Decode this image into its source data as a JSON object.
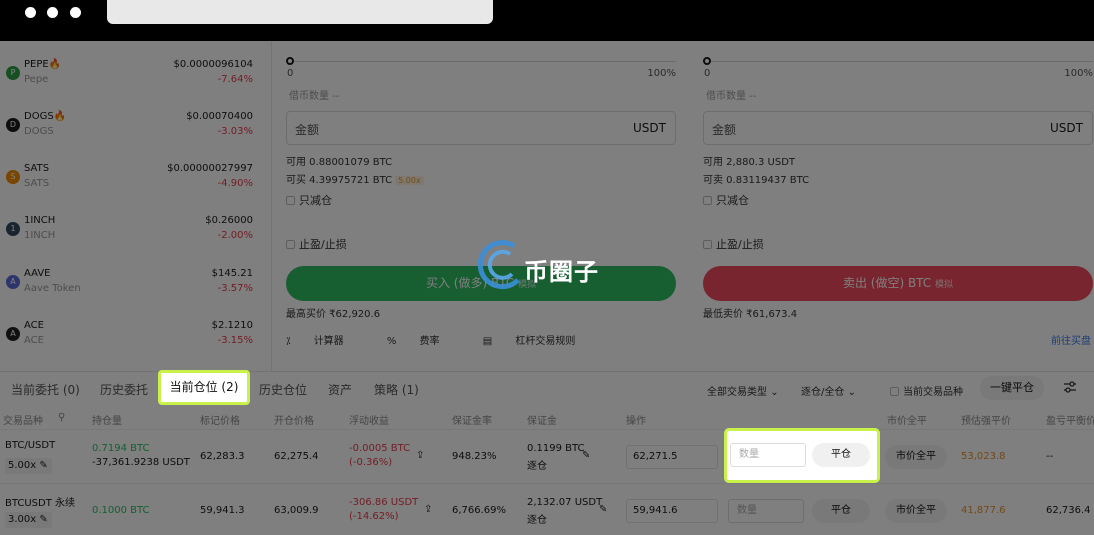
{
  "coins": [
    {
      "name": "PEPE",
      "sub": "Pepe",
      "price": "$0.0000096104",
      "change": "-7.64%",
      "hot": "🔥",
      "color": "#2f9e44",
      "glyph": "P"
    },
    {
      "name": "DOGS",
      "sub": "DOGS",
      "price": "$0.00070400",
      "change": "-3.03%",
      "hot": "🔥",
      "color": "#1a1a1a",
      "glyph": "D"
    },
    {
      "name": "SATS",
      "sub": "SATS",
      "price": "$0.00000027997",
      "change": "-4.90%",
      "hot": "",
      "color": "#f08c00",
      "glyph": "S"
    },
    {
      "name": "1INCH",
      "sub": "1INCH",
      "price": "$0.26000",
      "change": "-2.00%",
      "hot": "",
      "color": "#34495e",
      "glyph": "1"
    },
    {
      "name": "AAVE",
      "sub": "Aave Token",
      "price": "$145.21",
      "change": "-3.57%",
      "hot": "",
      "color": "#5b6bd6",
      "glyph": "A"
    },
    {
      "name": "ACE",
      "sub": "ACE",
      "price": "$2.1210",
      "change": "-3.15%",
      "hot": "",
      "color": "#222222",
      "glyph": "A"
    }
  ],
  "buy_panel": {
    "slider_min": "0",
    "slider_max": "100%",
    "borrow": "借币数量 --",
    "amount_placeholder": "金额",
    "amount_unit": "USDT",
    "available": "可用 0.88001079 BTC",
    "can_buy": "可买 4.39975721 BTC",
    "leverage": "5.00x",
    "reduce_only": "只减仓",
    "tp_sl": "止盈/止损",
    "button": "买入 (做多) BTC",
    "button_suffix": "模拟",
    "best_price": "最高买价 ₹62,920.6",
    "tool_calc": "计算器",
    "tool_rate": "费率",
    "tool_rules": "杠杆交易规则"
  },
  "sell_panel": {
    "slider_min": "0",
    "slider_max": "100%",
    "borrow": "借币数量 --",
    "amount_placeholder": "金额",
    "amount_unit": "USDT",
    "available": "可用 2,880.3 USDT",
    "can_sell": "可卖 0.83119437 BTC",
    "reduce_only": "只减仓",
    "tp_sl": "止盈/止损",
    "button": "卖出 (做空) BTC",
    "button_suffix": "模拟",
    "best_price": "最低卖价 ₹61,673.4",
    "link_spot": "前往买盘"
  },
  "tabs": {
    "open_orders": "当前委托 (0)",
    "order_history": "历史委托",
    "positions": "当前仓位 (2)",
    "position_history": "历史仓位",
    "assets": "资产",
    "strategy": "策略 (1)",
    "filter_type": "全部交易类型",
    "filter_mode": "逐仓/全仓",
    "filter_current": "当前交易品种",
    "close_all": "一键平仓"
  },
  "table": {
    "headers": [
      "交易品种",
      "持仓量",
      "标记价格",
      "开仓价格",
      "浮动收益",
      "保证金率",
      "保证金",
      "操作",
      "市价全平",
      "预估强平价",
      "盈亏平衡价"
    ],
    "rows": [
      {
        "symbol": "BTC/USDT",
        "leverage": "5.00x",
        "qty1": "0.7194 BTC",
        "qty2": "-37,361.9238 USDT",
        "mark": "62,283.3",
        "open": "62,275.4",
        "pnl1": "-0.0005 BTC",
        "pnl2": "(-0.36%)",
        "margin_rate": "948.23%",
        "margin": "0.1199 BTC",
        "margin_mode": "逐仓",
        "price_value": "62,271.5",
        "qty_placeholder": "数量",
        "close": "平仓",
        "market_close": "市价全平",
        "liq": "53,023.8",
        "breakeven": "--"
      },
      {
        "symbol": "BTCUSDT 永续",
        "leverage": "3.00x",
        "qty1": "0.1000 BTC",
        "qty2": "",
        "mark": "59,941.3",
        "open": "63,009.9",
        "pnl1": "-306.86 USDT",
        "pnl2": "(-14.62%)",
        "margin_rate": "6,766.69%",
        "margin": "2,132.07 USDT",
        "margin_mode": "逐仓",
        "price_value": "59,941.6",
        "qty_placeholder": "数量",
        "close": "平仓",
        "market_close": "市价全平",
        "liq": "41,877.6",
        "breakeven": "62,736.4"
      }
    ]
  },
  "watermark": "币圈子"
}
